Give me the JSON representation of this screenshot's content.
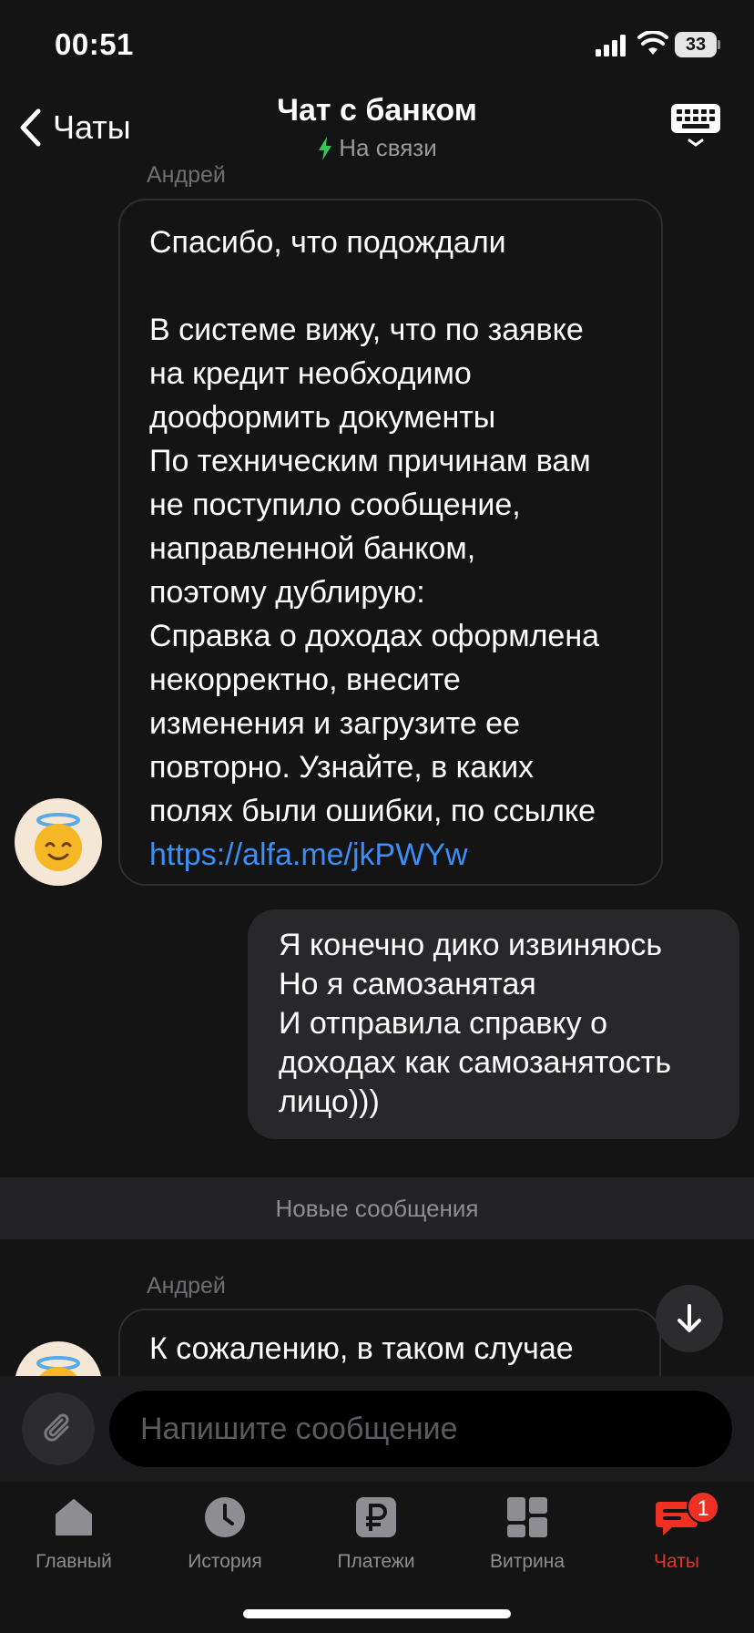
{
  "status_bar": {
    "time": "00:51",
    "battery": "33"
  },
  "header": {
    "back_label": "Чаты",
    "title": "Чат с банком",
    "status": "На связи"
  },
  "messages": [
    {
      "sender": "Андрей",
      "text": "Спасибо, что подождали\n\nВ системе вижу, что по заявке\nна кредит необходимо\nдооформить документы\nПо техническим причинам вам\nне поступило сообщение,\nнаправленной банком,\nпоэтому дублирую:\nСправка о доходах оформлена\nнекорректно, внесите\nизменения и загрузите ее\nповторно. Узнайте, в каких\nполях были ошибки, по ссылке\n",
      "link": "https://alfa.me/jkPWYw"
    },
    {
      "text": "Я конечно дико извиняюсь\nНо я самозанятая\nИ отправила справку о\nдоходах как самозанятость\nлицо)))"
    },
    {
      "sender": "Андрей",
      "text": "К сожалению, в таком случае"
    }
  ],
  "divider": "Новые сообщения",
  "composer": {
    "placeholder": "Напишите сообщение"
  },
  "tabs": [
    {
      "label": "Главный",
      "icon": "home-icon"
    },
    {
      "label": "История",
      "icon": "clock-icon"
    },
    {
      "label": "Платежи",
      "icon": "ruble-icon"
    },
    {
      "label": "Витрина",
      "icon": "showcase-icon"
    },
    {
      "label": "Чаты",
      "icon": "chat-icon",
      "badge": "1",
      "active": true
    }
  ],
  "colors": {
    "accent": "#ef3124",
    "link": "#3d8ef5",
    "online": "#34c759"
  }
}
